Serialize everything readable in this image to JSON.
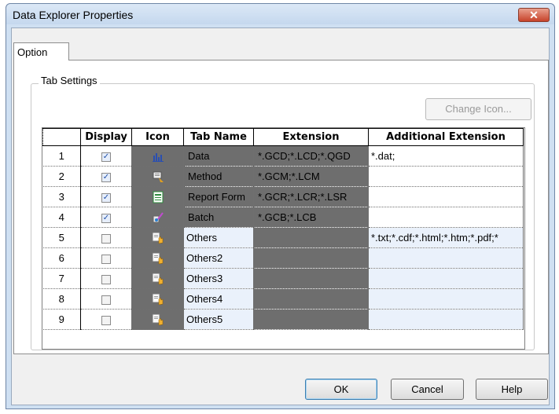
{
  "window": {
    "title": "Data Explorer Properties",
    "close_label": "✕"
  },
  "tabs": [
    {
      "label": "Option"
    }
  ],
  "group": {
    "label": "Tab Settings",
    "change_icon_label": "Change Icon..."
  },
  "table": {
    "headers": {
      "rownum": "",
      "display": "Display",
      "icon": "Icon",
      "tab_name": "Tab Name",
      "extension": "Extension",
      "additional": "Additional Extension"
    },
    "rows": [
      {
        "num": "1",
        "checked": true,
        "icon": "data-chart-icon",
        "name": "Data",
        "ext": "*.GCD;*.LCD;*.QGD",
        "add": "*.dat;"
      },
      {
        "num": "2",
        "checked": true,
        "icon": "method-icon",
        "name": "Method",
        "ext": "*.GCM;*.LCM",
        "add": ""
      },
      {
        "num": "3",
        "checked": true,
        "icon": "report-form-icon",
        "name": "Report Form",
        "ext": "*.GCR;*.LCR;*.LSR",
        "add": ""
      },
      {
        "num": "4",
        "checked": true,
        "icon": "batch-icon",
        "name": "Batch",
        "ext": "*.GCB;*.LCB",
        "add": ""
      },
      {
        "num": "5",
        "checked": false,
        "icon": "others-icon",
        "name": "Others",
        "ext": "",
        "add": "*.txt;*.cdf;*.html;*.htm;*.pdf;*"
      },
      {
        "num": "6",
        "checked": false,
        "icon": "others-icon",
        "name": "Others2",
        "ext": "",
        "add": ""
      },
      {
        "num": "7",
        "checked": false,
        "icon": "others-icon",
        "name": "Others3",
        "ext": "",
        "add": ""
      },
      {
        "num": "8",
        "checked": false,
        "icon": "others-icon",
        "name": "Others4",
        "ext": "",
        "add": ""
      },
      {
        "num": "9",
        "checked": false,
        "icon": "others-icon",
        "name": "Others5",
        "ext": "",
        "add": ""
      }
    ]
  },
  "buttons": {
    "ok": "OK",
    "cancel": "Cancel",
    "help": "Help"
  },
  "colors": {
    "accent": "#3c7fb1",
    "dark_cell": "#6e6e6e",
    "light_cell": "#eaf1fb"
  }
}
